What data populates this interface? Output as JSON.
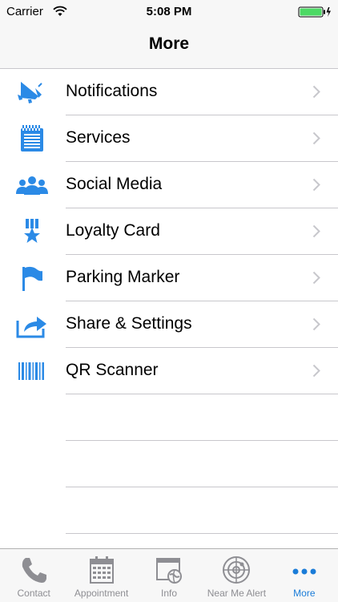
{
  "status_bar": {
    "carrier": "Carrier",
    "time": "5:08 PM"
  },
  "nav": {
    "title": "More"
  },
  "menu": {
    "items": [
      {
        "label": "Notifications",
        "icon": "megaphone-icon"
      },
      {
        "label": "Services",
        "icon": "notepad-icon"
      },
      {
        "label": "Social Media",
        "icon": "people-icon"
      },
      {
        "label": "Loyalty Card",
        "icon": "medal-star-icon"
      },
      {
        "label": "Parking Marker",
        "icon": "flag-icon"
      },
      {
        "label": "Share & Settings",
        "icon": "share-icon"
      },
      {
        "label": "QR Scanner",
        "icon": "barcode-icon"
      }
    ]
  },
  "tabs": [
    {
      "label": "Contact",
      "icon": "phone-icon",
      "active": false
    },
    {
      "label": "Appointment",
      "icon": "calendar-icon",
      "active": false
    },
    {
      "label": "Info",
      "icon": "globe-window-icon",
      "active": false
    },
    {
      "label": "Near Me Alert",
      "icon": "radar-icon",
      "active": false
    },
    {
      "label": "More",
      "icon": "more-dots-icon",
      "active": true
    }
  ],
  "colors": {
    "accent": "#1a7cd8",
    "icon_blue": "#2b8ae6",
    "tab_inactive": "#8e8e93",
    "battery_green": "#4cd964"
  }
}
